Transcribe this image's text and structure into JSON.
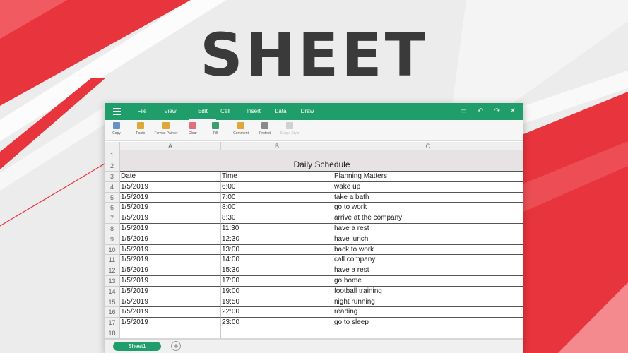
{
  "hero": {
    "title": "SHEET"
  },
  "menu": {
    "items": [
      {
        "label": "File",
        "name": "menu-file"
      },
      {
        "label": "View",
        "name": "menu-view"
      },
      {
        "label": "Edit",
        "name": "menu-edit",
        "active": true
      },
      {
        "label": "Cell",
        "name": "menu-cell"
      },
      {
        "label": "Insert",
        "name": "menu-insert"
      },
      {
        "label": "Data",
        "name": "menu-data"
      },
      {
        "label": "Draw",
        "name": "menu-draw"
      }
    ],
    "controls": [
      {
        "icon": "save-icon",
        "glyph": "▭"
      },
      {
        "icon": "undo-icon",
        "glyph": "↶"
      },
      {
        "icon": "redo-icon",
        "glyph": "↷"
      },
      {
        "icon": "close-icon",
        "glyph": "✕"
      }
    ]
  },
  "toolbar": {
    "tools": [
      {
        "label": "Copy",
        "icon": "copy-icon",
        "color": "#6b8fc7"
      },
      {
        "label": "Paste",
        "icon": "paste-icon",
        "color": "#e0a83a"
      },
      {
        "label": "Format Painter",
        "icon": "format-painter-icon",
        "color": "#e0a83a"
      },
      {
        "label": "Clear",
        "icon": "clear-icon",
        "color": "#e0707a"
      },
      {
        "label": "Fill",
        "icon": "fill-icon",
        "color": "#3da06a"
      },
      {
        "label": "Comment",
        "icon": "comment-icon",
        "color": "#e0a83a"
      },
      {
        "label": "Protect",
        "icon": "protect-icon",
        "color": "#8a8a8a"
      },
      {
        "label": "Shape Style",
        "icon": "shape-style-icon",
        "color": "#d0d0d0",
        "disabled": true
      }
    ]
  },
  "grid": {
    "columns": [
      "A",
      "B",
      "C"
    ],
    "title": "Daily Schedule",
    "header": [
      "Date",
      "Time",
      "Planning Matters"
    ],
    "rows": [
      [
        "1/5/2019",
        "6:00",
        "wake up"
      ],
      [
        "1/5/2019",
        "7:00",
        "take a bath"
      ],
      [
        "1/5/2019",
        "8:00",
        "go to work"
      ],
      [
        "1/5/2019",
        "8:30",
        "arrive at the company"
      ],
      [
        "1/5/2019",
        "11:30",
        "have a rest"
      ],
      [
        "1/5/2019",
        "12:30",
        "have lunch"
      ],
      [
        "1/5/2019",
        "13:00",
        "back to work"
      ],
      [
        "1/5/2019",
        "14:00",
        "call company"
      ],
      [
        "1/5/2019",
        "15:30",
        "have a rest"
      ],
      [
        "1/5/2019",
        "17:00",
        "go home"
      ],
      [
        "1/5/2019",
        "19:00",
        "football training"
      ],
      [
        "1/5/2019",
        "19:50",
        "night running"
      ],
      [
        "1/5/2019",
        "22:00",
        "reading"
      ],
      [
        "1/5/2019",
        "23:00",
        "go to sleep"
      ]
    ],
    "row_numbers": [
      "1",
      "2",
      "3",
      "4",
      "5",
      "6",
      "7",
      "8",
      "9",
      "10",
      "11",
      "12",
      "13",
      "14",
      "15",
      "16",
      "17",
      "18"
    ]
  },
  "sheets": {
    "tabs": [
      "Sheet1"
    ],
    "add_label": "+"
  },
  "colors": {
    "brand": "#1f9e6b",
    "accent_red": "#e8343c"
  }
}
